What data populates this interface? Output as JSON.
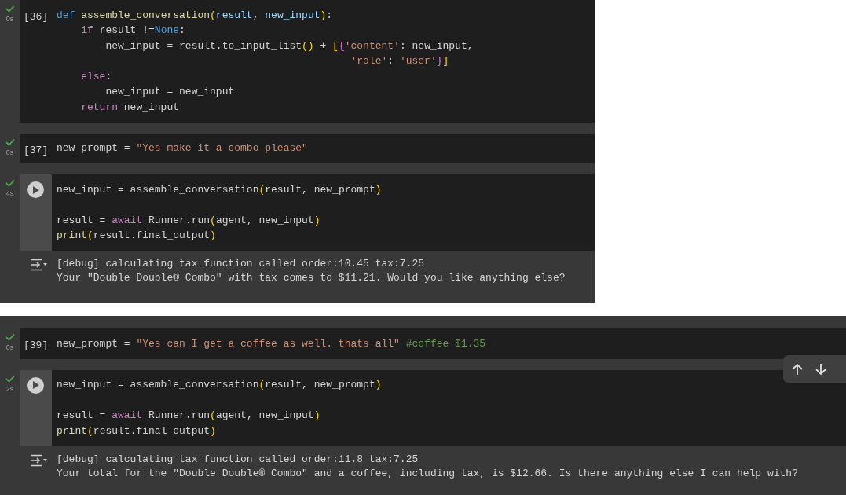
{
  "panels": [
    {
      "cells": [
        {
          "execution_count": "[36]",
          "succeeded": true,
          "time": "0s",
          "hovered": false,
          "lines": [
            {
              "segments": [
                {
                  "t": "def ",
                  "kind": "kw"
                },
                {
                  "t": "assemble_conversation",
                  "kind": "fn"
                },
                {
                  "t": "(",
                  "kind": "paren"
                },
                {
                  "t": "result",
                  "kind": "param"
                },
                {
                  "t": ", ",
                  "kind": "plain"
                },
                {
                  "t": "new_input",
                  "kind": "param"
                },
                {
                  "t": ")",
                  "kind": "paren"
                },
                {
                  "t": ":",
                  "kind": "plain"
                }
              ]
            },
            {
              "segments": [
                {
                  "t": "    if",
                  "kind": "ctrl"
                },
                {
                  "t": " result !=",
                  "kind": "plain"
                },
                {
                  "t": "None",
                  "kind": "kw"
                },
                {
                  "t": ":",
                  "kind": "plain"
                }
              ]
            },
            {
              "segments": [
                {
                  "t": "        new_input = result.to_input_list",
                  "kind": "plain"
                },
                {
                  "t": "()",
                  "kind": "paren"
                },
                {
                  "t": " + ",
                  "kind": "plain"
                },
                {
                  "t": "[",
                  "kind": "paren"
                },
                {
                  "t": "{",
                  "kind": "brace"
                },
                {
                  "t": "'content'",
                  "kind": "str"
                },
                {
                  "t": ": new_input,",
                  "kind": "plain"
                }
              ]
            },
            {
              "segments": [
                {
                  "t": "                                                'role'",
                  "kind": "str"
                },
                {
                  "t": ": ",
                  "kind": "plain"
                },
                {
                  "t": "'user'",
                  "kind": "str"
                },
                {
                  "t": "}",
                  "kind": "brace"
                },
                {
                  "t": "]",
                  "kind": "paren"
                }
              ]
            },
            {
              "segments": [
                {
                  "t": "    else",
                  "kind": "ctrl"
                },
                {
                  "t": ":",
                  "kind": "plain"
                }
              ]
            },
            {
              "segments": [
                {
                  "t": "        new_input = new_input",
                  "kind": "plain"
                }
              ]
            },
            {
              "segments": [
                {
                  "t": "    return",
                  "kind": "ctrl"
                },
                {
                  "t": " new_input",
                  "kind": "plain"
                }
              ]
            }
          ]
        },
        {
          "execution_count": "[37]",
          "succeeded": true,
          "time": "0s",
          "hovered": false,
          "lines": [
            {
              "segments": [
                {
                  "t": "new_prompt = ",
                  "kind": "plain"
                },
                {
                  "t": "\"Yes make it a combo please\"",
                  "kind": "str"
                }
              ]
            }
          ]
        },
        {
          "succeeded": true,
          "time": "4s",
          "hovered": true,
          "lines": [
            {
              "segments": [
                {
                  "t": "new_input = assemble_conversation",
                  "kind": "plain"
                },
                {
                  "t": "(",
                  "kind": "paren"
                },
                {
                  "t": "result, new_prompt",
                  "kind": "plain"
                },
                {
                  "t": ")",
                  "kind": "paren"
                }
              ]
            },
            {
              "blank_before": true,
              "segments": [
                {
                  "t": "result = ",
                  "kind": "plain"
                },
                {
                  "t": "await",
                  "kind": "ctrl"
                },
                {
                  "t": " Runner.run",
                  "kind": "plain"
                },
                {
                  "t": "(",
                  "kind": "paren"
                },
                {
                  "t": "agent, new_input",
                  "kind": "plain"
                },
                {
                  "t": ")",
                  "kind": "paren"
                }
              ]
            },
            {
              "segments": [
                {
                  "t": "print",
                  "kind": "fn"
                },
                {
                  "t": "(",
                  "kind": "paren"
                },
                {
                  "t": "result.final_output",
                  "kind": "plain"
                },
                {
                  "t": ")",
                  "kind": "paren"
                }
              ]
            }
          ],
          "output": [
            "[debug] calculating tax function called order:10.45 tax:7.25",
            "Your \"Double Double® Combo\" with tax comes to $11.21. Would you like anything else?"
          ]
        }
      ]
    },
    {
      "toolbar": [
        {
          "kind": "up"
        },
        {
          "kind": "down"
        }
      ],
      "cells": [
        {
          "execution_count": "[39]",
          "succeeded": true,
          "time": "0s",
          "hovered": false,
          "lines": [
            {
              "segments": [
                {
                  "t": "new_prompt = ",
                  "kind": "plain"
                },
                {
                  "t": "\"Yes can I get a coffee as well. thats all\"",
                  "kind": "str"
                },
                {
                  "t": " #coffee $1.35",
                  "kind": "comment"
                }
              ]
            }
          ]
        },
        {
          "succeeded": true,
          "time": "2s",
          "hovered": true,
          "lines": [
            {
              "segments": [
                {
                  "t": "new_input = assemble_conversation",
                  "kind": "plain"
                },
                {
                  "t": "(",
                  "kind": "paren"
                },
                {
                  "t": "result, new_prompt",
                  "kind": "plain"
                },
                {
                  "t": ")",
                  "kind": "paren"
                }
              ]
            },
            {
              "blank_before": true,
              "segments": [
                {
                  "t": "result = ",
                  "kind": "plain"
                },
                {
                  "t": "await",
                  "kind": "ctrl"
                },
                {
                  "t": " Runner.run",
                  "kind": "plain"
                },
                {
                  "t": "(",
                  "kind": "paren"
                },
                {
                  "t": "agent, new_input",
                  "kind": "plain"
                },
                {
                  "t": ")",
                  "kind": "paren"
                }
              ]
            },
            {
              "segments": [
                {
                  "t": "print",
                  "kind": "fn"
                },
                {
                  "t": "(",
                  "kind": "paren"
                },
                {
                  "t": "result.final_output",
                  "kind": "plain"
                },
                {
                  "t": ")",
                  "kind": "paren"
                }
              ]
            }
          ],
          "output": [
            "[debug] calculating tax function called order:11.8 tax:7.25",
            "Your total for the \"Double Double® Combo\" and a coffee, including tax, is $12.66. Is there anything else I can help with?"
          ]
        }
      ]
    }
  ]
}
